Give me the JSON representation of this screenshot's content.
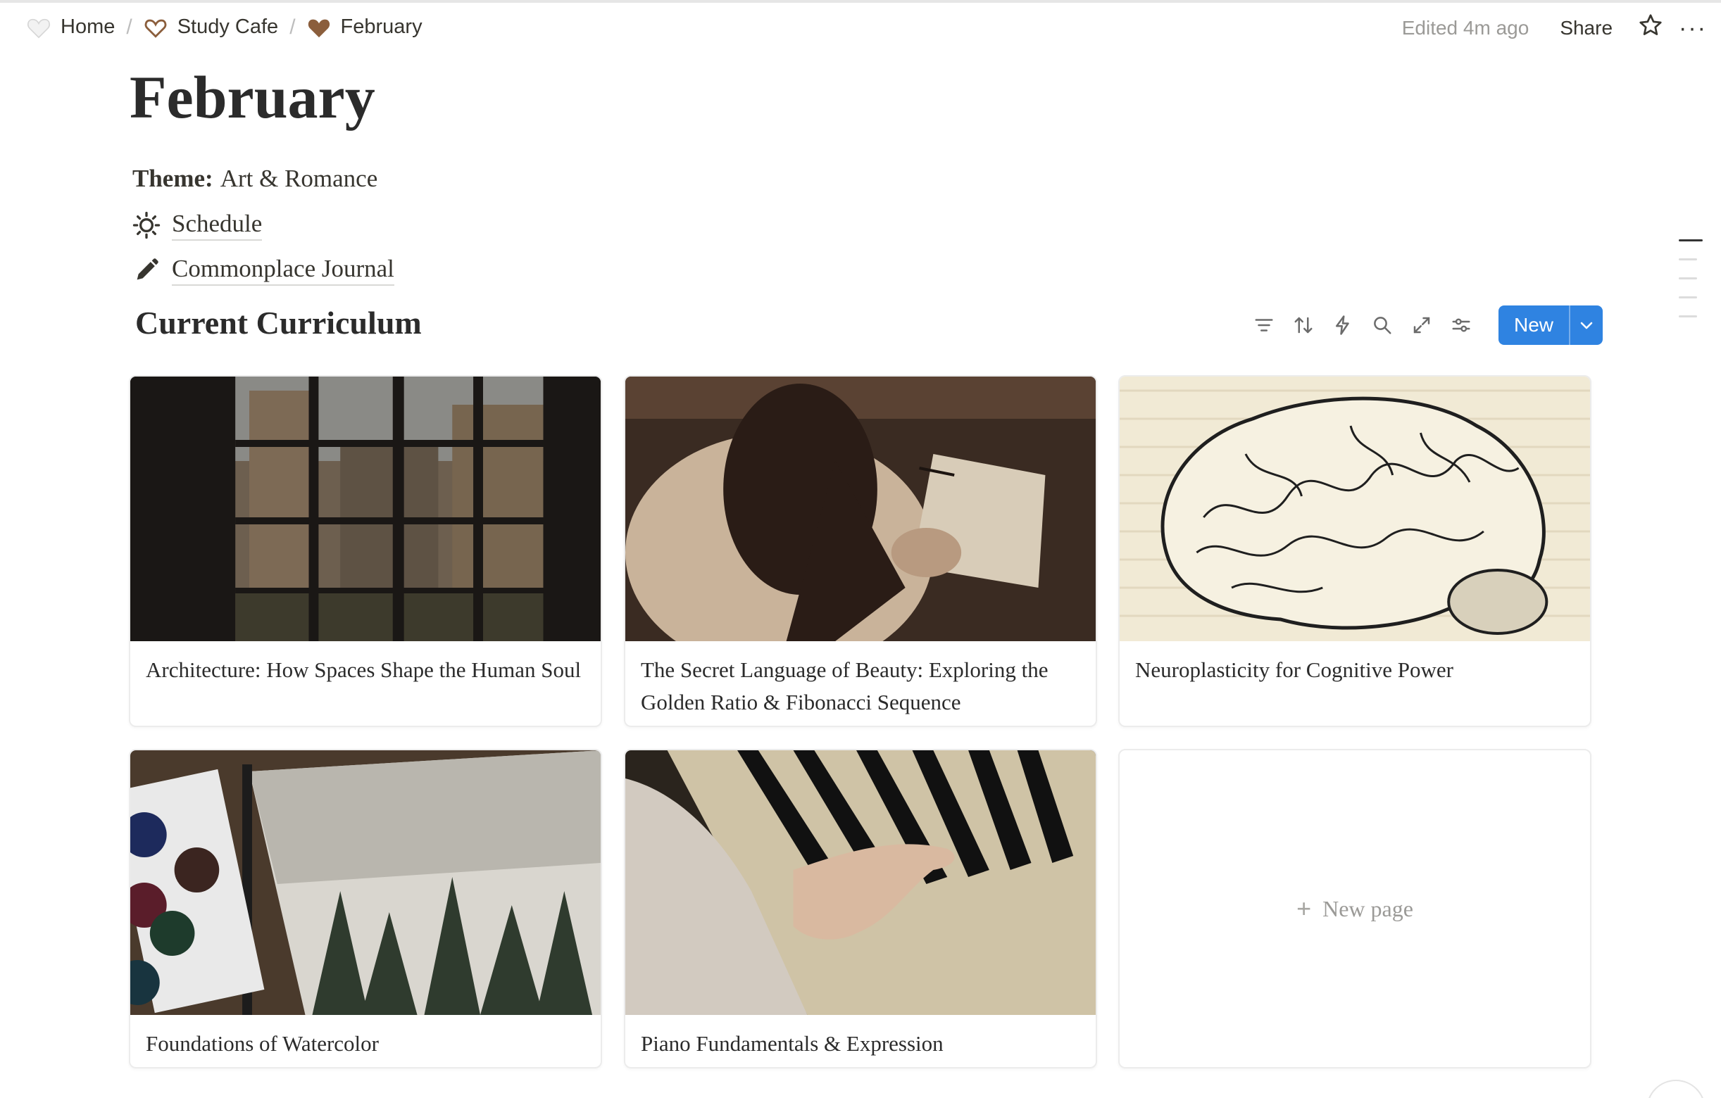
{
  "breadcrumb": {
    "items": [
      {
        "label": "Home",
        "icon": "heart-white-icon"
      },
      {
        "label": "Study Cafe",
        "icon": "heart-outline-icon"
      },
      {
        "label": "February",
        "icon": "heart-brown-icon"
      }
    ],
    "separator": "/"
  },
  "topbar": {
    "edited": "Edited 4m ago",
    "share": "Share",
    "more": "···"
  },
  "page": {
    "title": "February",
    "theme_label": "Theme:",
    "theme_value": "Art & Romance",
    "links": [
      {
        "label": "Schedule",
        "icon": "sun-icon"
      },
      {
        "label": "Commonplace Journal",
        "icon": "pencil-icon"
      }
    ]
  },
  "database": {
    "title": "Current Curriculum",
    "toolbar_icons": [
      "filter-icon",
      "sort-icon",
      "automation-icon",
      "search-icon",
      "expand-icon",
      "settings-icon"
    ],
    "new_label": "New",
    "cards": [
      {
        "title": "Architecture: How Spaces Shape the Human Soul",
        "cover": "gothic-window-cover"
      },
      {
        "title": "The Secret Language of Beauty: Exploring the Golden Ratio & Fibonacci Sequence",
        "cover": "drawing-woman-cover"
      },
      {
        "title": "Neuroplasticity for Cognitive Power",
        "cover": "brain-illustration-cover"
      },
      {
        "title": "Foundations of Watercolor",
        "cover": "watercolor-forest-cover"
      },
      {
        "title": "Piano Fundamentals & Expression",
        "cover": "piano-hands-cover"
      }
    ],
    "new_page": "New page"
  },
  "colors": {
    "accent": "#2f83e1",
    "text": "#37352f",
    "muted": "#9b9a97",
    "heart_brown": "#8b5e3c"
  }
}
